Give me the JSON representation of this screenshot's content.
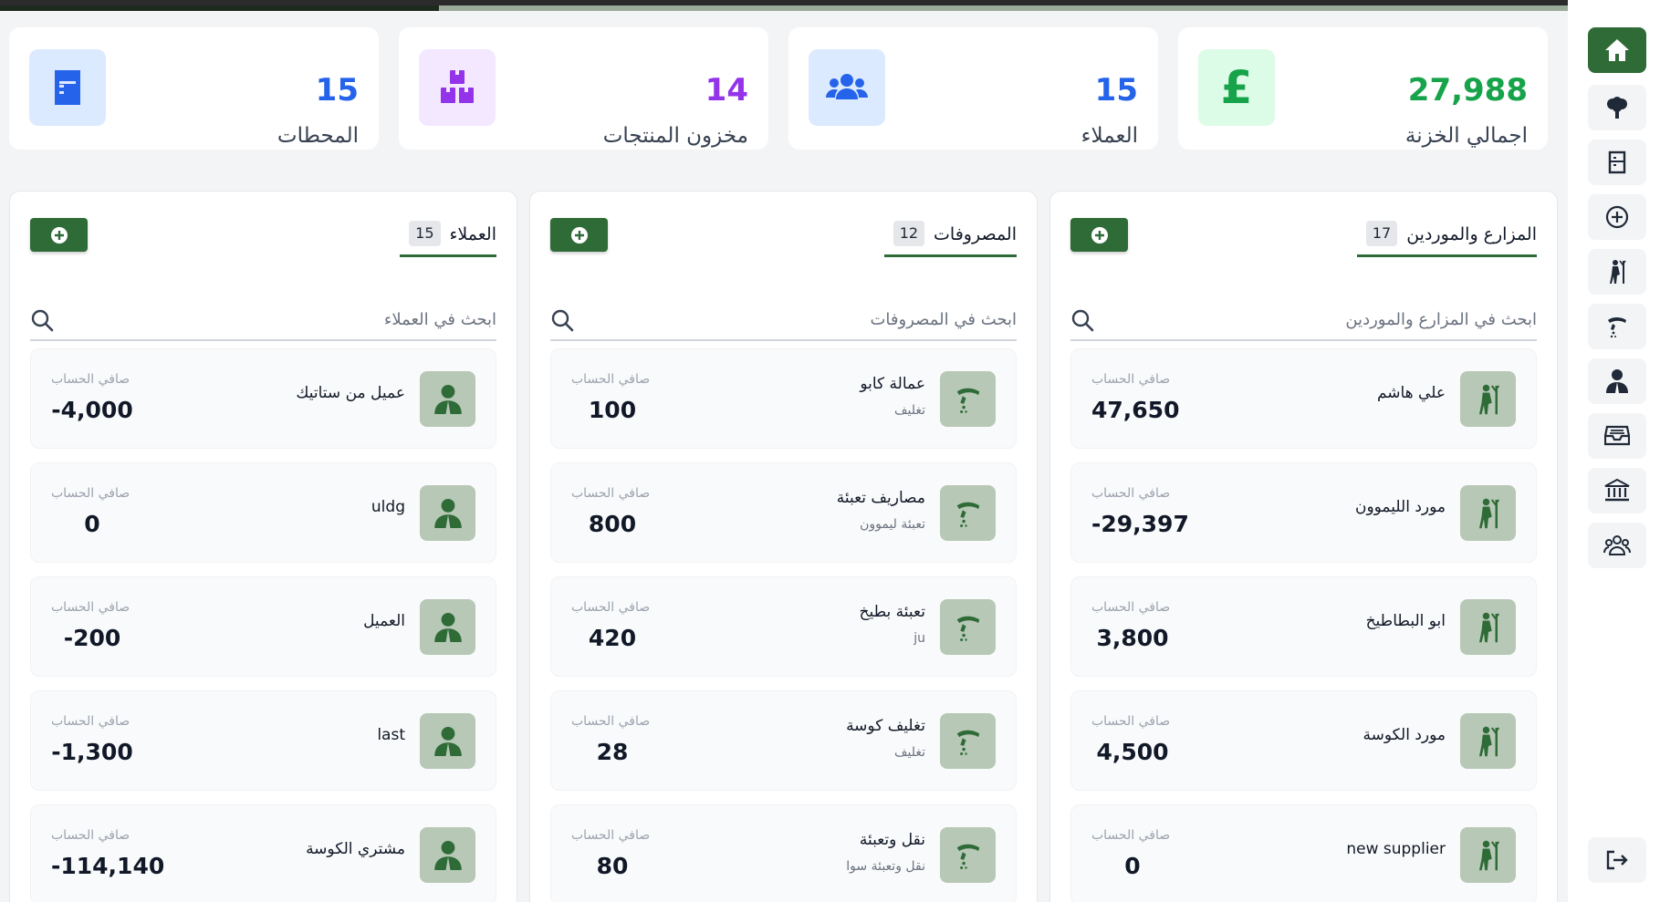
{
  "stats": [
    {
      "value": "27,988",
      "label": "اجمالي الخزنة",
      "icon": "pound-icon",
      "color": "#16a34a",
      "bg": "#dcfce7"
    },
    {
      "value": "15",
      "label": "العملاء",
      "icon": "users-icon",
      "color": "#2563eb",
      "bg": "#dbeafe"
    },
    {
      "value": "14",
      "label": "مخزون المنتجات",
      "icon": "boxes-icon",
      "color": "#9333ea",
      "bg": "#f3e8ff"
    },
    {
      "value": "15",
      "label": "المحطات",
      "icon": "station-icon",
      "color": "#2563eb",
      "bg": "#dbeafe"
    }
  ],
  "panels": [
    {
      "title": "المزارع والموردين",
      "count": "17",
      "search_placeholder": "ابحث في المزارع والموردين",
      "item_icon": "farmer-icon",
      "rows": [
        {
          "name": "علي هاشم",
          "sub": "",
          "balance_label": "صافي الحساب",
          "balance": "47,650"
        },
        {
          "name": "مورد الليموون",
          "sub": "",
          "balance_label": "صافي الحساب",
          "balance": "-29,397"
        },
        {
          "name": "ابو البطاطيخ",
          "sub": "",
          "balance_label": "صافي الحساب",
          "balance": "3,800"
        },
        {
          "name": "مورد الكوسة",
          "sub": "",
          "balance_label": "صافي الحساب",
          "balance": "4,500"
        },
        {
          "name": "new supplier",
          "sub": "",
          "balance_label": "صافي الحساب",
          "balance": "0"
        }
      ]
    },
    {
      "title": "المصروفات",
      "count": "12",
      "search_placeholder": "ابحث في المصروفات",
      "item_icon": "hand-money-icon",
      "rows": [
        {
          "name": "عمالة كابو",
          "sub": "تغليف",
          "balance_label": "صافي الحساب",
          "balance": "100"
        },
        {
          "name": "مصاريف تعبئة",
          "sub": "تعبئة ليموون",
          "balance_label": "صافي الحساب",
          "balance": "800"
        },
        {
          "name": "تعبئة بطيخ",
          "sub": "ju",
          "balance_label": "صافي الحساب",
          "balance": "420"
        },
        {
          "name": "تغليف كوسة",
          "sub": "تغليف",
          "balance_label": "صافي الحساب",
          "balance": "28"
        },
        {
          "name": "نقل وتعبئة",
          "sub": "نقل وتعبئة سوا",
          "balance_label": "صافي الحساب",
          "balance": "80"
        }
      ]
    },
    {
      "title": "العملاء",
      "count": "15",
      "search_placeholder": "ابحث في العملاء",
      "item_icon": "customer-icon",
      "rows": [
        {
          "name": "عميل من ستاتيك",
          "sub": "",
          "balance_label": "صافي الحساب",
          "balance": "-4,000"
        },
        {
          "name": "uldg",
          "sub": "",
          "balance_label": "صافي الحساب",
          "balance": "0"
        },
        {
          "name": "العميل",
          "sub": "",
          "balance_label": "صافي الحساب",
          "balance": "-200"
        },
        {
          "name": "last",
          "sub": "",
          "balance_label": "صافي الحساب",
          "balance": "-1,300"
        },
        {
          "name": "مشتري الكوسة",
          "sub": "",
          "balance_label": "صافي الحساب",
          "balance": "-114,140"
        }
      ]
    }
  ],
  "sidebar": [
    {
      "icon": "home-icon",
      "active": true
    },
    {
      "icon": "tree-icon"
    },
    {
      "icon": "station-icon"
    },
    {
      "icon": "plus-circle-icon"
    },
    {
      "icon": "farmer-icon"
    },
    {
      "icon": "hand-money-icon"
    },
    {
      "icon": "customer-icon"
    },
    {
      "icon": "inbox-icon"
    },
    {
      "icon": "bank-icon"
    },
    {
      "icon": "team-icon"
    },
    {
      "icon": "logout-icon"
    }
  ],
  "colors": {
    "accent": "#2f6b37",
    "avatar_bg": "#b7c8b6"
  }
}
